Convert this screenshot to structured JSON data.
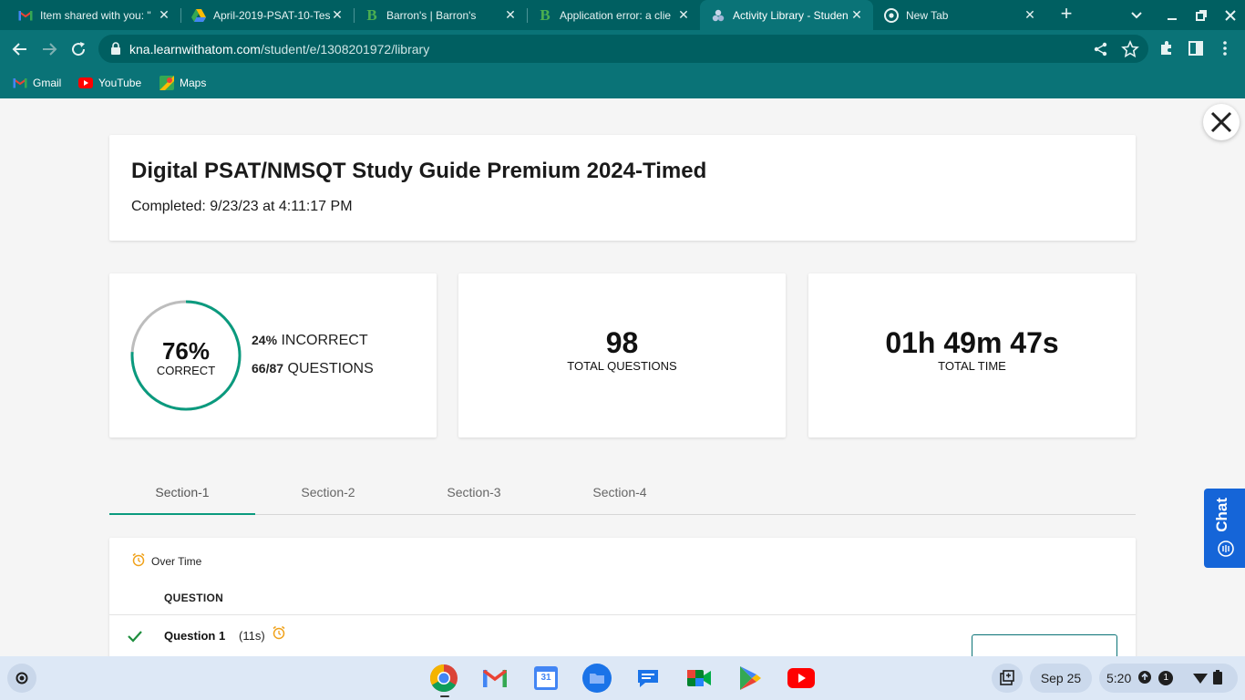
{
  "browser": {
    "tabs": [
      {
        "title": "Item shared with you: \"",
        "icon": "gmail-icon"
      },
      {
        "title": "April-2019-PSAT-10-Tes",
        "icon": "google-drive-icon"
      },
      {
        "title": "Barron's | Barron's",
        "icon": "barrons-b-icon"
      },
      {
        "title": "Application error: a clie",
        "icon": "barrons-b-icon"
      },
      {
        "title": "Activity Library - Studen",
        "icon": "atom-icon",
        "active": true
      },
      {
        "title": "New Tab",
        "icon": "chrome-icon"
      }
    ],
    "url_host": "kna.learnwithatom.com",
    "url_path": "/student/e/1308201972/library",
    "bookmarks": [
      {
        "label": "Gmail",
        "icon": "gmail-icon"
      },
      {
        "label": "YouTube",
        "icon": "youtube-icon"
      },
      {
        "label": "Maps",
        "icon": "maps-icon"
      }
    ]
  },
  "page": {
    "title": "Digital PSAT/NMSQT Study Guide Premium 2024-Timed",
    "completed": "Completed: 9/23/23 at 4:11:17 PM",
    "score": {
      "percent_text": "76%",
      "percent_value": 76,
      "correct_label": "CORRECT",
      "incorrect_value": "24%",
      "incorrect_label": "INCORRECT",
      "questions_value": "66/87",
      "questions_label": "QUESTIONS"
    },
    "total_questions": {
      "value": "98",
      "label": "TOTAL QUESTIONS"
    },
    "total_time": {
      "value": "01h 49m 47s",
      "label": "TOTAL TIME"
    },
    "sections": [
      "Section-1",
      "Section-2",
      "Section-3",
      "Section-4"
    ],
    "active_section": "Section-1",
    "over_time_label": "Over Time",
    "column_header": "QUESTION",
    "questions": [
      {
        "title": "Question 1",
        "time": "(11s)",
        "status": "correct",
        "over_time": true
      }
    ],
    "chat_label": "Chat"
  },
  "shelf": {
    "apps": [
      "chrome-icon",
      "gmail-icon",
      "calendar-icon",
      "files-icon",
      "messages-icon",
      "meet-icon",
      "play-store-icon",
      "youtube-icon"
    ],
    "calendar_day": "31",
    "date": "Sep 25",
    "time": "5:20",
    "notification_count": "1"
  },
  "colors": {
    "chrome_dark": "#005f61",
    "chrome": "#0a7377",
    "ring_correct": "#0a9a7e",
    "ring_rest": "#bdbdbd",
    "chat": "#1565d8",
    "overtime_clock": "#f0a21b"
  }
}
